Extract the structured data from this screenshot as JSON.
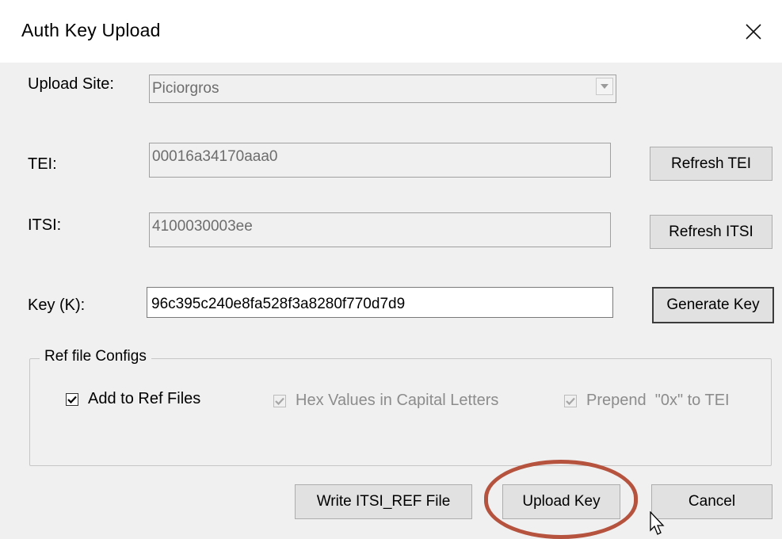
{
  "dialog": {
    "title": "Auth Key Upload"
  },
  "upload_site": {
    "label": "Upload Site:",
    "value": "Piciorgros"
  },
  "tei": {
    "label": "TEI:",
    "value": "00016a34170aaa0",
    "refresh_label": "Refresh TEI"
  },
  "itsi": {
    "label": "ITSI:",
    "value": "4100030003ee",
    "refresh_label": "Refresh ITSI"
  },
  "key": {
    "label": "Key (K):",
    "value": "96c395c240e8fa528f3a8280f770d7d9",
    "generate_label": "Generate Key"
  },
  "ref_configs": {
    "title": "Ref file Configs",
    "add_to_ref": {
      "label": "Add to Ref Files",
      "checked": true,
      "enabled": true
    },
    "hex_capital": {
      "label": "Hex Values in Capital Letters",
      "checked": true,
      "enabled": false
    },
    "prepend_0x": {
      "label": "Prepend  \"0x\" to TEI",
      "checked": true,
      "enabled": false
    }
  },
  "buttons": {
    "write_ref": "Write ITSI_REF File",
    "upload": "Upload Key",
    "cancel": "Cancel"
  },
  "colors": {
    "highlight": "#b5533f",
    "background": "#f0f0f0"
  }
}
